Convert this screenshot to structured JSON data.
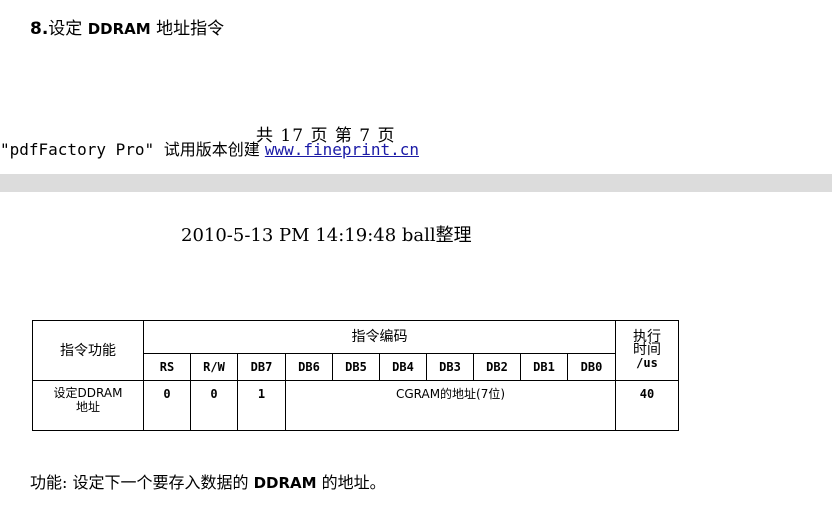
{
  "section": {
    "number": "8.",
    "title_prefix": "设定 ",
    "title_bold": "DDRAM",
    "title_suffix": " 地址指令"
  },
  "footer": {
    "page_counter": "共 17 页 第 7 页",
    "notice_prefix": "\"pdfFactory Pro\" ",
    "notice_cn": "试用版本创建 ",
    "link_text": "www.fineprint.cn"
  },
  "header": {
    "text": "2010-5-13 PM 14:19:48 ball整理"
  },
  "table": {
    "col_function": "指令功能",
    "col_code": "指令编码",
    "col_exec_top": "执行",
    "col_exec_mid": "时间",
    "col_exec_unit": "/us",
    "bits": [
      "RS",
      "R/W",
      "DB7",
      "DB6",
      "DB5",
      "DB4",
      "DB3",
      "DB2",
      "DB1",
      "DB0"
    ],
    "row": {
      "function_line1": "设定DDRAM",
      "function_line2": "地址",
      "rs": "0",
      "rw": "0",
      "db7": "1",
      "address": "CGRAM的地址(7位)",
      "time": "40"
    }
  },
  "description": {
    "prefix": "功能: 设定下一个要存入数据的 ",
    "bold": "DDRAM",
    "suffix": " 的地址。"
  }
}
